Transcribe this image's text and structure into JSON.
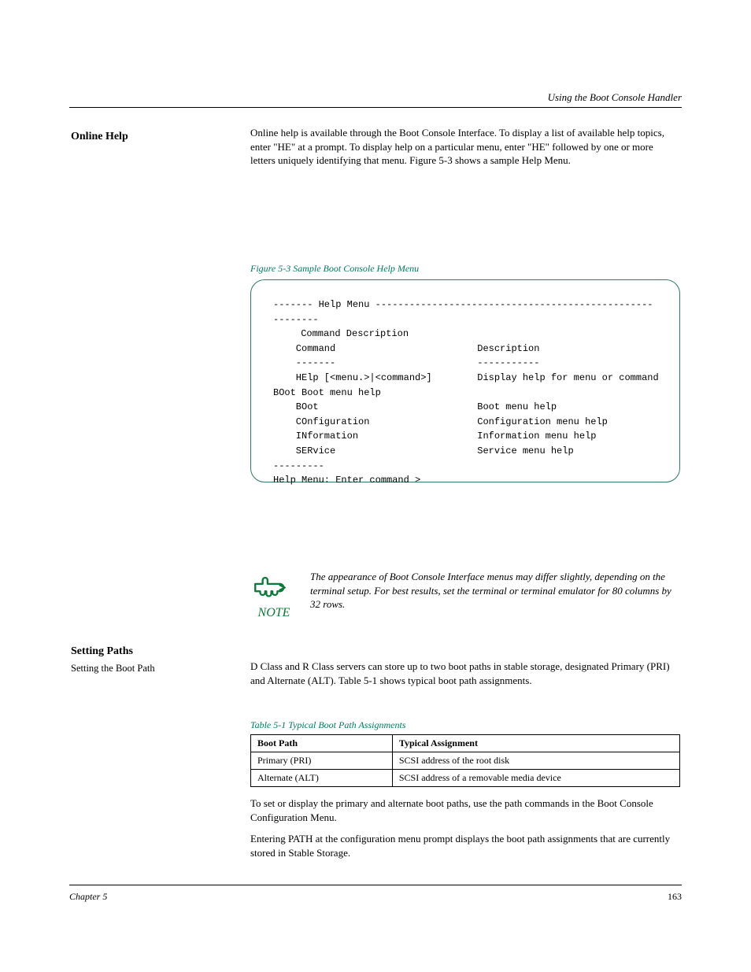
{
  "header": {
    "running_title": "Using the Boot Console Handler"
  },
  "sections": {
    "online_help": {
      "left_label": "Online Help",
      "text": "Online help is available through the Boot Console Interface. To display a list of available help topics, enter \"HE\" at a prompt. To display help on a particular menu, enter \"HE\" followed by one or more letters uniquely identifying that menu. Figure 5-3 shows a sample Help Menu."
    },
    "figure": {
      "caption": "Figure 5-3   Sample Boot Console Help Menu",
      "lines": [
        "------- Help Menu ---------------------------------------------------------",
        "",
        "    Command                         Description",
        "    -------                         -----------",
        "    HElp [<menu.>|<command>]        Display help for menu or command",
        "",
        "    BOot                            Boot menu help",
        "    COnfiguration                   Configuration menu help",
        "    INformation                     Information menu help",
        "    SERvice                         Service menu help",
        "",
        "---------",
        "Help Menu: Enter command >"
      ]
    },
    "note": {
      "icon_label": "NOTE",
      "text": "The appearance of Boot Console Interface menus may differ slightly, depending on the terminal setup. For best results, set the terminal or terminal emulator for 80 columns by 32 rows."
    },
    "setting_paths": {
      "left_label": "Setting Paths",
      "sub_label": "Setting the Boot Path",
      "para1": "D Class and R Class servers can store up to two boot paths in stable storage, designated Primary (PRI) and Alternate (ALT). Table 5-1 shows typical boot path assignments.",
      "table_title": "Table 5-1   Typical Boot Path Assignments",
      "table": {
        "headers": [
          "Boot Path",
          "Typical Assignment"
        ],
        "rows": [
          [
            "Primary (PRI)",
            "SCSI address of the root disk"
          ],
          [
            "Alternate (ALT)",
            "SCSI address of a removable media device"
          ]
        ]
      },
      "para2": "To set or display the primary and alternate boot paths, use the path commands in the Boot Console Configuration Menu.",
      "para3": "Entering PATH at the configuration menu prompt displays the boot path assignments that are currently stored in Stable Storage."
    }
  },
  "footer": {
    "chapter": "Chapter 5",
    "page": "163"
  }
}
